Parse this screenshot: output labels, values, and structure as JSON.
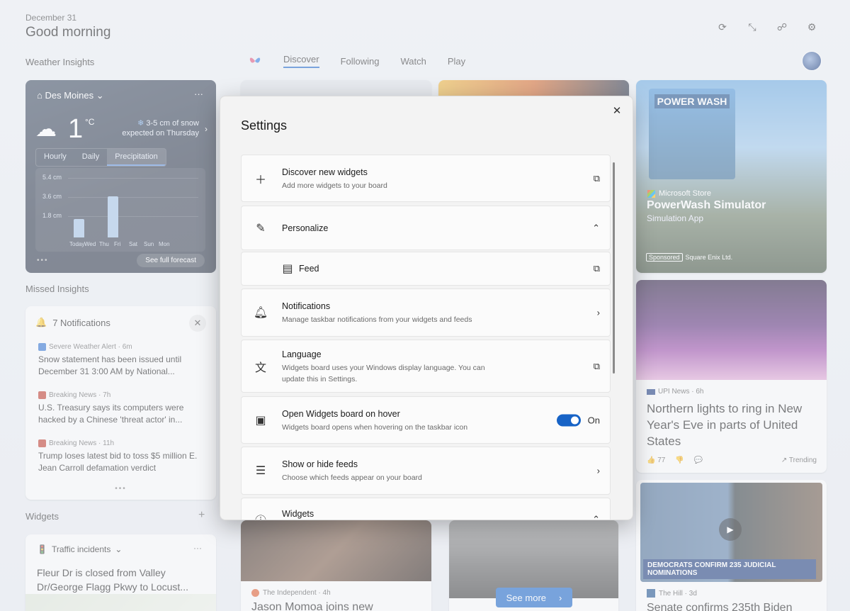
{
  "header": {
    "date": "December 31",
    "greeting": "Good morning",
    "icons": [
      "refresh-icon",
      "collapse-icon",
      "share-icon",
      "gear-icon"
    ]
  },
  "sections": {
    "weather_insights": "Weather Insights",
    "missed_insights": "Missed Insights",
    "widgets": "Widgets"
  },
  "nav": {
    "tabs": [
      "Discover",
      "Following",
      "Watch",
      "Play"
    ],
    "active": "Discover"
  },
  "weather": {
    "location": "Des Moines",
    "temperature": "1",
    "unit": "°C",
    "snow_line1": "3-5 cm of snow",
    "snow_line2": "expected on Thursday",
    "tabs": [
      "Hourly",
      "Daily",
      "Precipitation"
    ],
    "active_tab": "Precipitation",
    "y_labels": [
      "5.4 cm",
      "3.6 cm",
      "1.8 cm"
    ],
    "days": [
      "Today",
      "Wed",
      "Thu",
      "Fri",
      "Sat",
      "Sun",
      "Mon"
    ],
    "forecast_button": "See full forecast"
  },
  "chart_data": {
    "type": "bar",
    "categories": [
      "Today",
      "Wed",
      "Thu",
      "Fri",
      "Sat",
      "Sun",
      "Mon"
    ],
    "values": [
      1.7,
      0,
      3.8,
      0,
      0,
      0,
      0
    ],
    "ylabel": "",
    "ylim": [
      0,
      5.4
    ],
    "yticks": [
      "1.8 cm",
      "3.6 cm",
      "5.4 cm"
    ]
  },
  "notifications": {
    "title": "7 Notifications",
    "items": [
      {
        "source": "Severe Weather Alert · 6m",
        "text": "Snow statement has been issued until December 31 3:00 AM by National..."
      },
      {
        "source": "Breaking News · 7h",
        "text": "U.S. Treasury says its computers were hacked by a Chinese 'threat actor' in..."
      },
      {
        "source": "Breaking News · 11h",
        "text": "Trump loses latest bid to toss $5 million E. Jean Carroll defamation verdict"
      }
    ]
  },
  "traffic": {
    "title": "Traffic incidents",
    "message": "Fleur Dr is closed from Valley Dr/George Flagg Pkwy to Locust..."
  },
  "feed": {
    "powerwash": {
      "store": "Microsoft Store",
      "name": "PowerWash Simulator",
      "sub": "Simulation App",
      "logo_text": "POWER WASH",
      "sponsored": "Sponsored",
      "advertiser": "Square Enix Ltd."
    },
    "aurora": {
      "source": "UPI News · 6h",
      "title": "Northern lights to ring in New Year's Eve in parts of United States",
      "likes": "77",
      "trending": "Trending"
    },
    "hill": {
      "source": "The Hill · 3d",
      "title": "Senate confirms 235th Biden",
      "banner": "DEMOCRATS CONFIRM 235 JUDICIAL NOMINATIONS"
    },
    "independent": {
      "source": "The Independent · 4h",
      "title": "Jason Momoa joins new"
    },
    "see_more": "See more"
  },
  "settings": {
    "title": "Settings",
    "rows": [
      {
        "title": "Discover new widgets",
        "desc": "Add more widgets to your board",
        "icon": "plus-icon",
        "action": "external-link-icon"
      },
      {
        "title": "Personalize",
        "desc": "",
        "icon": "pencil-icon",
        "action": "chevron-up-icon"
      },
      {
        "title": "Feed",
        "desc": "",
        "icon": "feed-icon",
        "action": "external-link-icon"
      },
      {
        "title": "Notifications",
        "desc": "Manage taskbar notifications from your widgets and feeds",
        "icon": "bell-icon",
        "action": "chevron-right-icon"
      },
      {
        "title": "Language",
        "desc": "Widgets board uses your Windows display language. You can update this in Settings.",
        "icon": "language-icon",
        "action": "external-link-icon"
      },
      {
        "title": "Open Widgets board on hover",
        "desc": "Widgets board opens when hovering on the taskbar icon",
        "icon": "board-icon",
        "action": "toggle",
        "toggle_label": "On"
      },
      {
        "title": "Show or hide feeds",
        "desc": "Choose which feeds appear on your board",
        "icon": "feeds-icon",
        "action": "chevron-right-icon"
      },
      {
        "title": "Widgets",
        "desc": "",
        "icon": "info-icon",
        "action": "chevron-up-icon"
      }
    ]
  }
}
